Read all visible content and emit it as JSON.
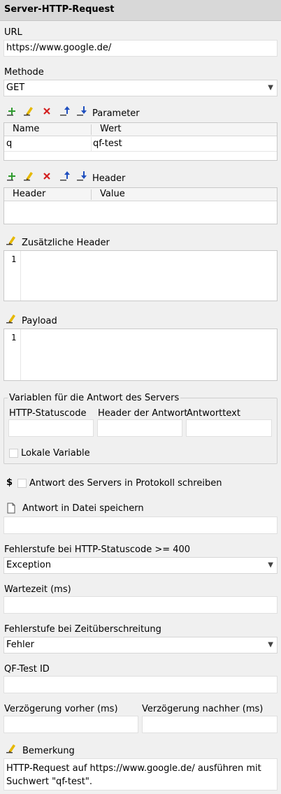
{
  "title": "Server-HTTP-Request",
  "url": {
    "label": "URL",
    "value": "https://www.google.de/"
  },
  "method": {
    "label": "Methode",
    "value": "GET"
  },
  "parameters": {
    "label": "Parameter",
    "columns": [
      "Name",
      "Wert"
    ],
    "rows": [
      {
        "name": "q",
        "value": "qf-test"
      }
    ]
  },
  "headers": {
    "label": "Header",
    "columns": [
      "Header",
      "Value"
    ]
  },
  "extra_headers": {
    "label": "Zusätzliche Header",
    "line": "1"
  },
  "payload": {
    "label": "Payload",
    "line": "1"
  },
  "response_vars": {
    "legend": "Variablen für die Antwort des Servers",
    "status_label": "HTTP-Statuscode",
    "header_label": "Header der Antwort",
    "text_label": "Antworttext",
    "local_label": "Lokale Variable"
  },
  "log_response": {
    "prefix": "$",
    "label": "Antwort des Servers in Protokoll schreiben"
  },
  "save_response": {
    "label": "Antwort in Datei speichern"
  },
  "error_level_status": {
    "label": "Fehlerstufe bei HTTP-Statuscode >= 400",
    "value": "Exception"
  },
  "timeout": {
    "label": "Wartezeit (ms)"
  },
  "error_level_timeout": {
    "label": "Fehlerstufe bei Zeitüberschreitung",
    "value": "Fehler"
  },
  "qftest_id": {
    "label": "QF-Test ID"
  },
  "delay_before": {
    "label": "Verzögerung vorher (ms)"
  },
  "delay_after": {
    "label": "Verzögerung nachher (ms)"
  },
  "comment": {
    "label": "Bemerkung",
    "line1": "HTTP-Request auf https://www.google.de/ ausführen mit",
    "line2": "Suchwert \"qf-test\"."
  },
  "icons": {
    "add": "add-icon",
    "edit": "edit-icon",
    "delete": "delete-icon",
    "up": "move-up-icon",
    "down": "move-down-icon",
    "file": "file-icon",
    "dropdown": "chevron-down-icon"
  }
}
